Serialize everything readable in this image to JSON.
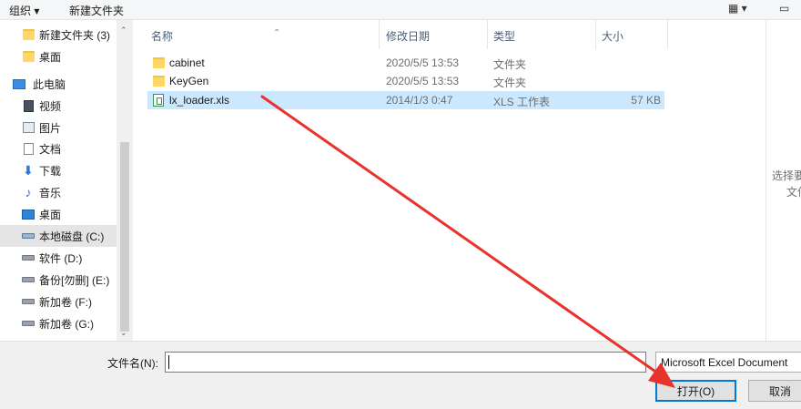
{
  "toolbar": {
    "organize": "组织 ▾",
    "new_folder": "新建文件夹",
    "view_icon": "view-options-icon",
    "pane_icon": "preview-pane-icon"
  },
  "sidebar": {
    "items": [
      {
        "label": "新建文件夹 (3)",
        "icon": "folder-icon"
      },
      {
        "label": "桌面",
        "icon": "folder-icon"
      },
      {
        "label": "此电脑",
        "icon": "computer-icon"
      },
      {
        "label": "视频",
        "icon": "video-icon"
      },
      {
        "label": "图片",
        "icon": "picture-icon"
      },
      {
        "label": "文档",
        "icon": "document-icon"
      },
      {
        "label": "下载",
        "icon": "download-icon"
      },
      {
        "label": "音乐",
        "icon": "music-icon"
      },
      {
        "label": "桌面",
        "icon": "desktop-icon"
      },
      {
        "label": "本地磁盘 (C:)",
        "icon": "drive-icon"
      },
      {
        "label": "软件 (D:)",
        "icon": "drive-icon"
      },
      {
        "label": "备份[勿删] (E:)",
        "icon": "drive-icon"
      },
      {
        "label": "新加卷 (F:)",
        "icon": "drive-icon"
      },
      {
        "label": "新加卷 (G:)",
        "icon": "drive-icon"
      }
    ]
  },
  "filelist": {
    "columns": {
      "name": "名称",
      "date": "修改日期",
      "type": "类型",
      "size": "大小"
    },
    "rows": [
      {
        "name": "cabinet",
        "date": "2020/5/5 13:53",
        "type": "文件夹",
        "size": ""
      },
      {
        "name": "KeyGen",
        "date": "2020/5/5 13:53",
        "type": "文件夹",
        "size": ""
      },
      {
        "name": "lx_loader.xls",
        "date": "2014/1/3 0:47",
        "type": "XLS 工作表",
        "size": "57 KB"
      }
    ]
  },
  "preview": {
    "line1": "选择要",
    "line2": "文件"
  },
  "bottom": {
    "filename_label": "文件名(N):",
    "filename_value": "",
    "filter_value": "Microsoft Excel Document",
    "open_label": "打开(O)",
    "cancel_label": "取消"
  },
  "colors": {
    "selection": "#cce8ff",
    "annotation_arrow": "#e8322c",
    "primary_button_border": "#0078d7"
  }
}
